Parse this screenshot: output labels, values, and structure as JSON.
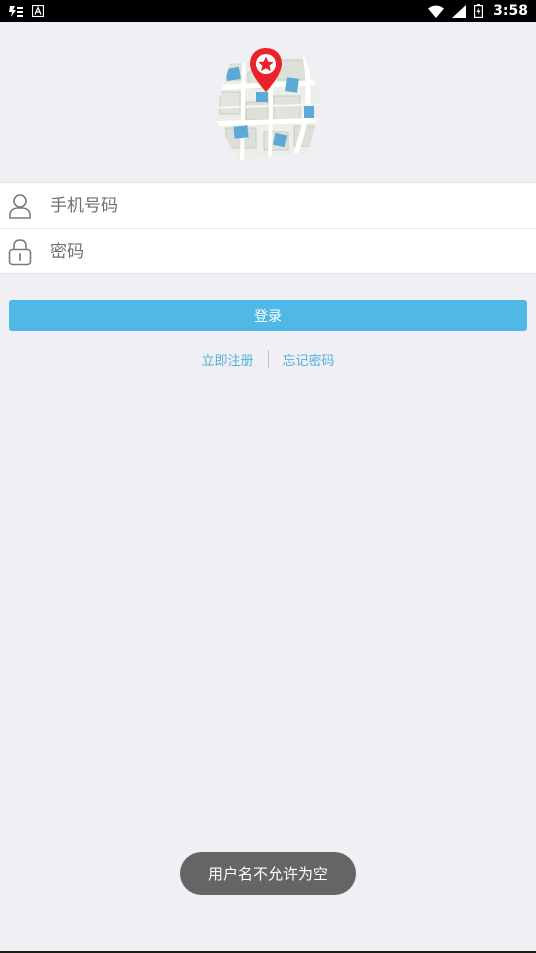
{
  "status_bar": {
    "time": "3:58",
    "left_icons": [
      "notification-icon",
      "a-icon"
    ],
    "right_icons": [
      "wifi-icon",
      "signal-icon",
      "battery-icon"
    ]
  },
  "login_form": {
    "phone_placeholder": "手机号码",
    "phone_value": "",
    "password_placeholder": "密码",
    "password_value": "",
    "phone_icon": "user-icon",
    "password_icon": "lock-icon"
  },
  "actions": {
    "login_label": "登录",
    "register_label": "立即注册",
    "forgot_label": "忘记密码"
  },
  "toast": {
    "message": "用户名不允许为空"
  },
  "colors": {
    "accent": "#4fb8e6",
    "link": "#4fb0dc",
    "background": "#efeff4",
    "pin": "#e8232b"
  }
}
